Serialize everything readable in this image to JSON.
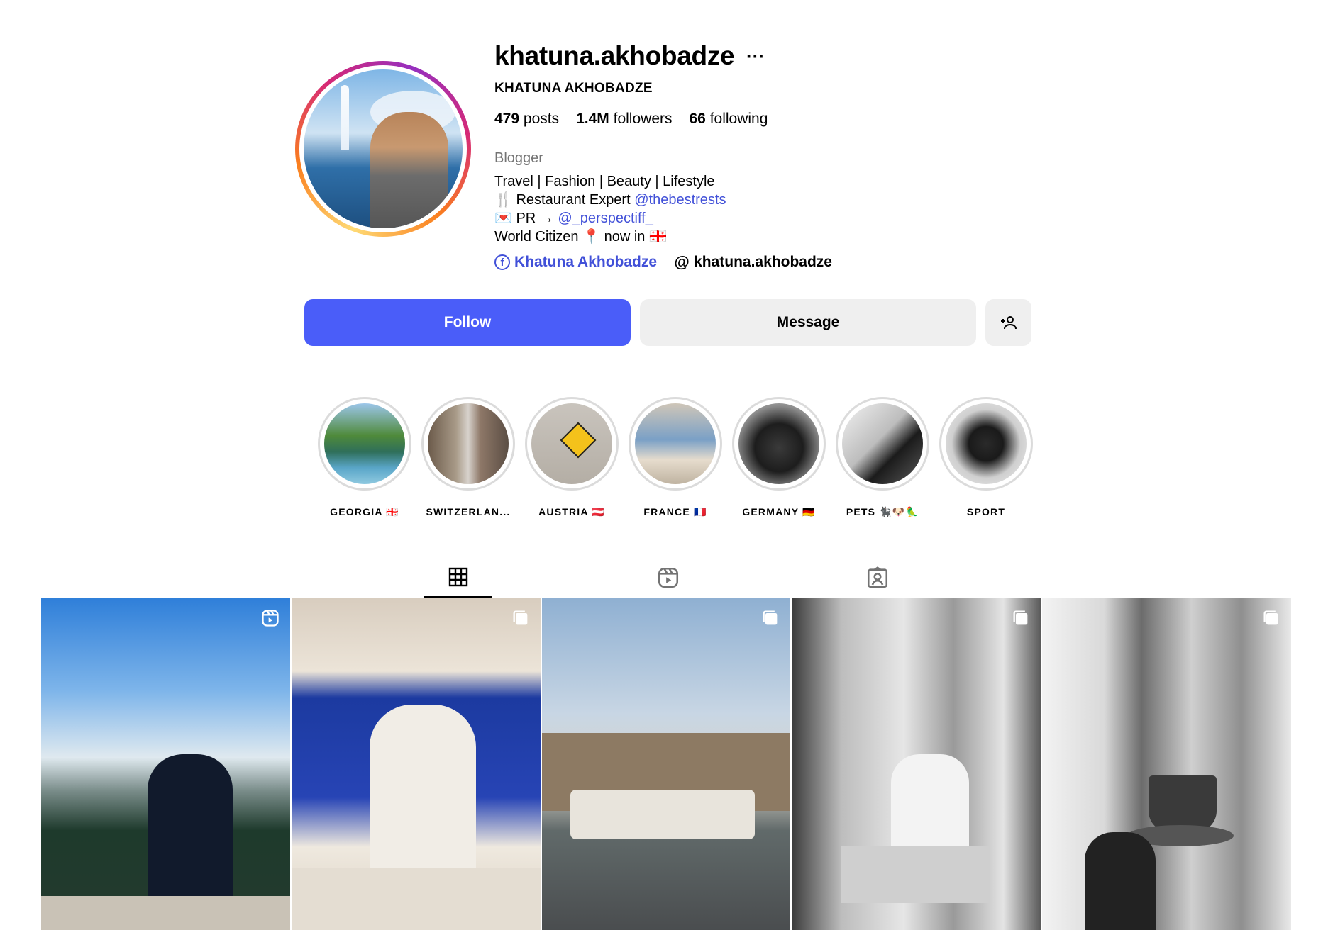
{
  "profile": {
    "username": "khatuna.akhobadze",
    "more_label": "···",
    "full_name": "KHATUNA AKHOBADZE",
    "stats": {
      "posts_count": "479",
      "posts_label": "posts",
      "followers_count": "1.4M",
      "followers_label": "followers",
      "following_count": "66",
      "following_label": "following"
    },
    "category": "Blogger",
    "bio": {
      "line1": "Travel | Fashion | Beauty | Lifestyle",
      "line2_text": "🍴 Restaurant Expert ",
      "line2_mention": "@thebestrests",
      "line3_text": "💌 PR → ",
      "line3_mention": "@_perspectiff_",
      "line4": "World Citizen 📍 now in 🇬🇪"
    },
    "links": {
      "facebook_label": "Khatuna Akhobadze",
      "threads_label": "khatuna.akhobadze"
    }
  },
  "actions": {
    "follow_label": "Follow",
    "message_label": "Message",
    "add_user_icon": "add-user-icon"
  },
  "highlights": [
    {
      "label": "GEORGIA 🇬🇪"
    },
    {
      "label": "SWITZERLAN..."
    },
    {
      "label": "AUSTRIA 🇦🇹"
    },
    {
      "label": "FRANCE 🇫🇷"
    },
    {
      "label": "GERMANY 🇩🇪"
    },
    {
      "label": "PETS 🐈‍⬛🐶🦜"
    },
    {
      "label": "SPORT"
    }
  ],
  "tabs": [
    {
      "icon": "grid-icon",
      "active": true
    },
    {
      "icon": "reels-icon",
      "active": false
    },
    {
      "icon": "tagged-icon",
      "active": false
    }
  ],
  "posts": [
    {
      "badge_icon": "reel-icon"
    },
    {
      "badge_icon": "carousel-icon"
    },
    {
      "badge_icon": "carousel-icon"
    },
    {
      "badge_icon": "carousel-icon"
    },
    {
      "badge_icon": "carousel-icon"
    }
  ],
  "colors": {
    "follow_button": "#4a5df9",
    "link": "#4150d8",
    "secondary_button": "#efefef"
  }
}
